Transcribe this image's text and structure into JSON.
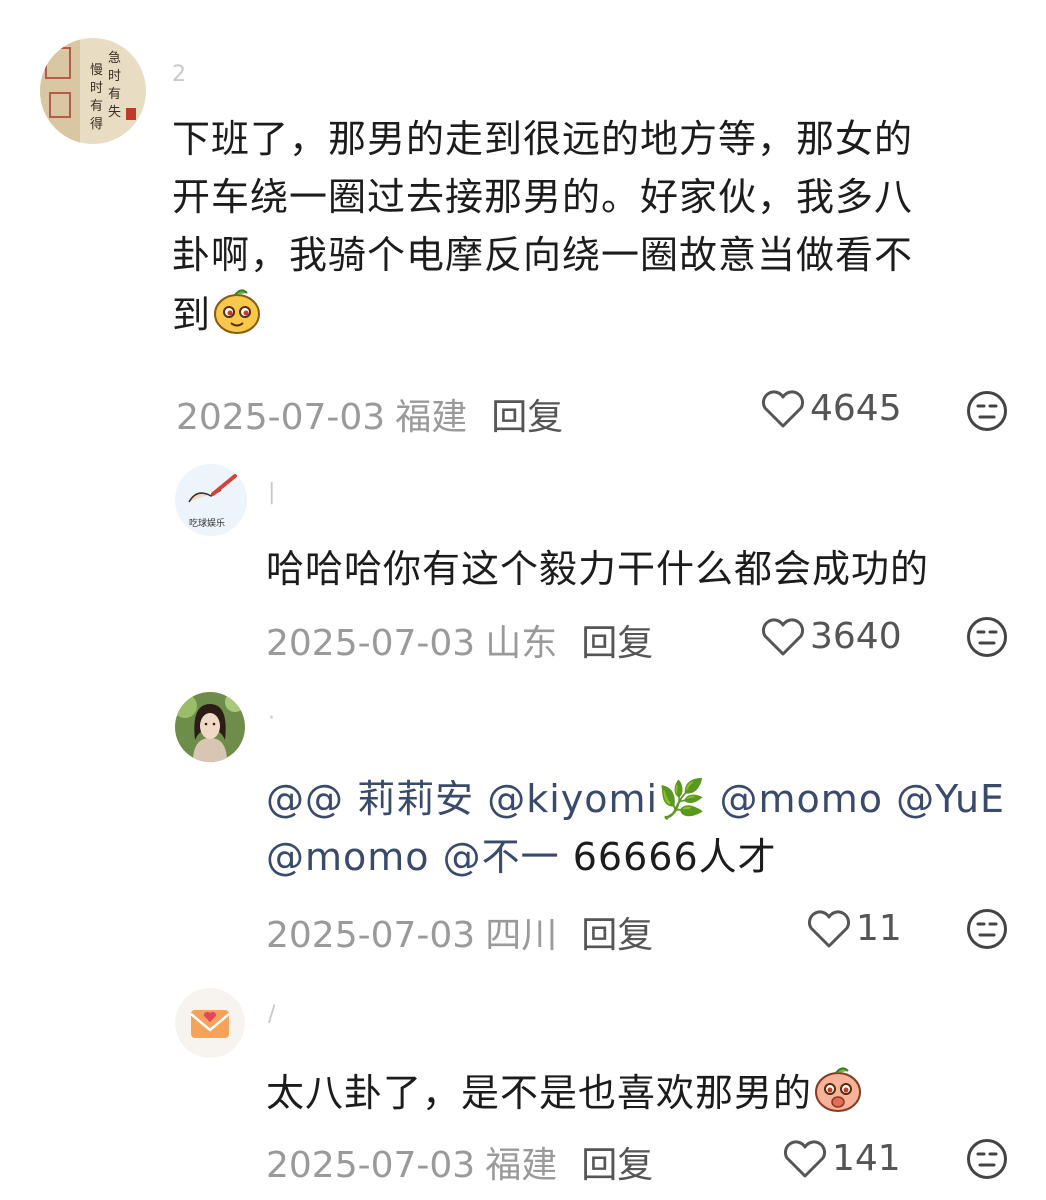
{
  "comments": [
    {
      "username": "2",
      "text_lines": [
        "下班了，那男的走到很远的地方等，那女的",
        "开车绕一圈过去接那男的。好家伙，我多八",
        "卦啊，我骑个电摩反向绕一圈故意当做看不",
        "到"
      ],
      "date": "2025-07-03",
      "location": "福建",
      "reply_label": "回复",
      "likes": "4645",
      "avatar_icon": "calligraphy-avatar",
      "avatar_text": "急时有失 慢时有得"
    },
    {
      "username": "|",
      "text": "哈哈哈你有这个毅力干什么都会成功的",
      "date": "2025-07-03",
      "location": "山东",
      "reply_label": "回复",
      "likes": "3640",
      "avatar_icon": "drawing-avatar",
      "avatar_text": "吃球娱乐"
    },
    {
      "username": "·",
      "mentions_line1": [
        "@@ 莉莉安",
        "@kiyomi🌿",
        "@momo",
        "@YuE"
      ],
      "mentions_line2": [
        "@momo",
        "@不一"
      ],
      "suffix": "66666人才",
      "date": "2025-07-03",
      "location": "四川",
      "reply_label": "回复",
      "likes": "11",
      "avatar_icon": "portrait-avatar"
    },
    {
      "username": "/",
      "text": "太八卦了，是不是也喜欢那男的",
      "date": "2025-07-03",
      "location": "福建",
      "reply_label": "回复",
      "likes": "141",
      "avatar_icon": "envelope-heart-avatar"
    }
  ],
  "icons": {
    "like": "heart-outline-icon",
    "emoji": "neutral-face-icon",
    "inline_1": "smirk-sticker-emoji",
    "inline_4": "shy-sticker-emoji"
  },
  "colors": {
    "text": "#1c1c1c",
    "meta": "#9a9a9a",
    "reply": "#555555",
    "mention": "#3a4a6b"
  }
}
